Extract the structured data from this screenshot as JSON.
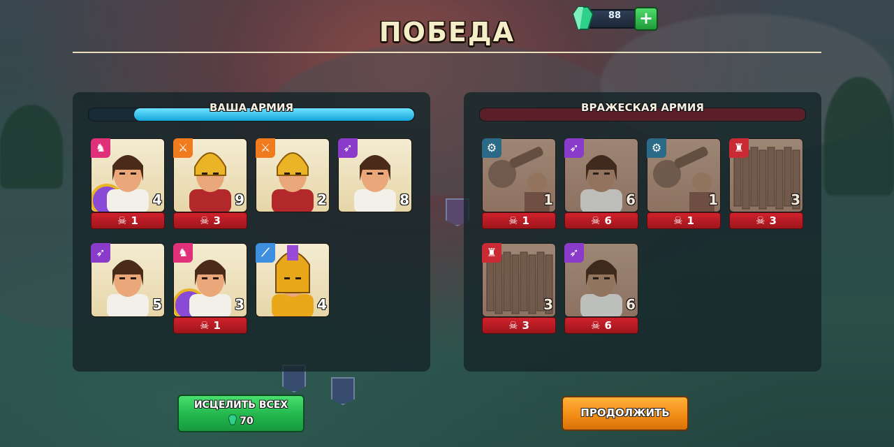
{
  "title": "ПОБЕДА",
  "currency": {
    "gems": "88",
    "add_symbol": "+"
  },
  "player_army": {
    "title": "ВАША АРМИЯ",
    "units": [
      {
        "type": "cavalry",
        "icon": "horse-icon",
        "count": "4",
        "losses": "1"
      },
      {
        "type": "infantry",
        "icon": "sword-icon",
        "count": "9",
        "losses": "3"
      },
      {
        "type": "infantry",
        "icon": "sword-icon",
        "count": "2",
        "losses": ""
      },
      {
        "type": "archer",
        "icon": "bow-icon",
        "count": "8",
        "losses": ""
      },
      {
        "type": "archer",
        "icon": "bow-icon",
        "count": "5",
        "losses": ""
      },
      {
        "type": "cavalry",
        "icon": "horse-icon",
        "count": "3",
        "losses": "1"
      },
      {
        "type": "hoplite",
        "icon": "spear-icon",
        "count": "4",
        "losses": ""
      }
    ]
  },
  "enemy_army": {
    "title": "ВРАЖЕСКАЯ АРМИЯ",
    "units": [
      {
        "type": "siege",
        "icon": "catapult-icon",
        "count": "1",
        "losses": "1"
      },
      {
        "type": "archer",
        "icon": "bow-icon",
        "count": "6",
        "losses": "6"
      },
      {
        "type": "siege",
        "icon": "catapult-icon",
        "count": "1",
        "losses": "1"
      },
      {
        "type": "wall",
        "icon": "tower-icon",
        "count": "3",
        "losses": "3"
      },
      {
        "type": "wall",
        "icon": "tower-icon",
        "count": "3",
        "losses": "3"
      },
      {
        "type": "archer",
        "icon": "bow-icon",
        "count": "6",
        "losses": "6"
      }
    ]
  },
  "player_army_health": 0.86,
  "enemy_army_health": 0.0,
  "buttons": {
    "heal_all": {
      "label": "ИСЦЕЛИТЬ ВСЕХ",
      "cost": "70"
    },
    "continue": {
      "label": "ПРОДОЛЖИТЬ"
    }
  },
  "colors": {
    "cavalry": "#e0307a",
    "infantry": "#f07a1e",
    "archer": "#8a3bc9",
    "hoplite": "#3f8fe0",
    "siege": "#2b6a86",
    "wall": "#c92a33"
  }
}
